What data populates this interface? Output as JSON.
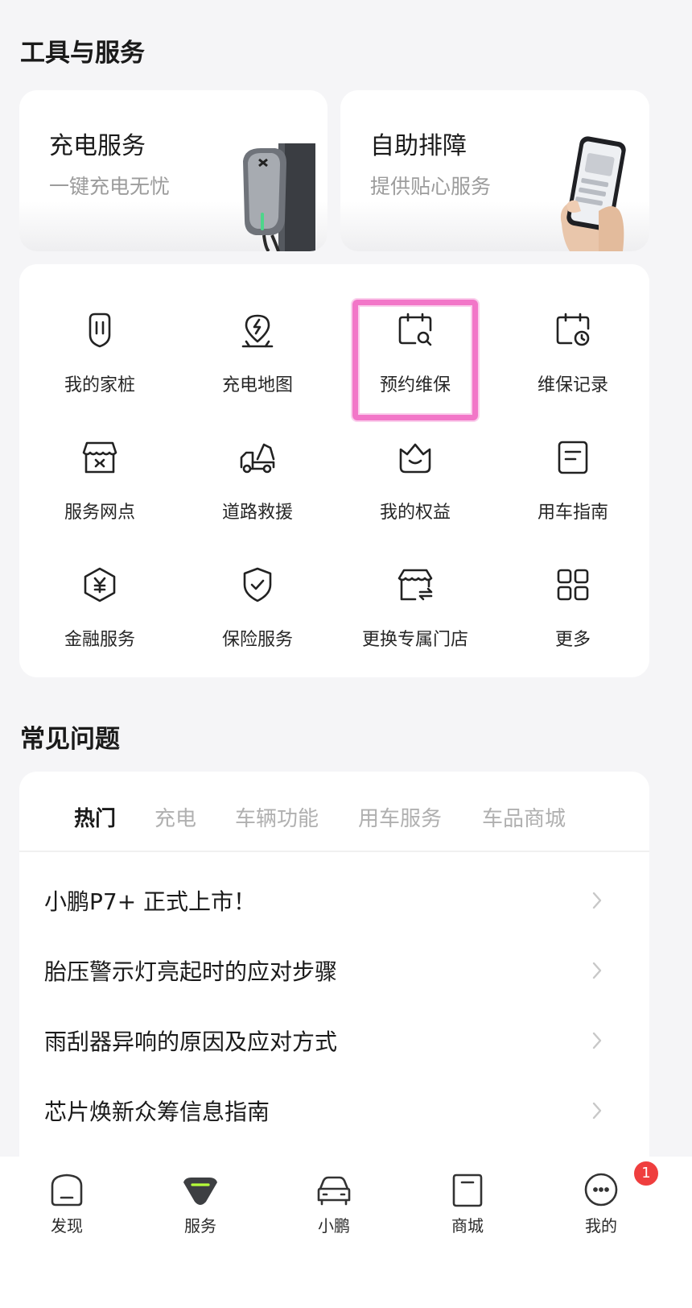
{
  "tools": {
    "title": "工具与服务",
    "feature_cards": [
      {
        "title": "充电服务",
        "subtitle": "一键充电无忧"
      },
      {
        "title": "自助排障",
        "subtitle": "提供贴心服务"
      }
    ],
    "grid": [
      {
        "label": "我的家桩",
        "icon": "charging-pile-icon"
      },
      {
        "label": "充电地图",
        "icon": "charging-map-icon"
      },
      {
        "label": "预约维保",
        "icon": "calendar-search-icon"
      },
      {
        "label": "维保记录",
        "icon": "calendar-clock-icon"
      },
      {
        "label": "服务网点",
        "icon": "service-store-icon"
      },
      {
        "label": "道路救援",
        "icon": "tow-truck-icon"
      },
      {
        "label": "我的权益",
        "icon": "benefits-basket-icon"
      },
      {
        "label": "用车指南",
        "icon": "guide-document-icon"
      },
      {
        "label": "金融服务",
        "icon": "finance-yen-icon"
      },
      {
        "label": "保险服务",
        "icon": "insurance-shield-icon"
      },
      {
        "label": "更换专属门店",
        "icon": "switch-store-icon"
      },
      {
        "label": "更多",
        "icon": "more-grid-icon"
      }
    ]
  },
  "faq": {
    "title": "常见问题",
    "tabs": [
      {
        "label": "热门",
        "active": true
      },
      {
        "label": "充电",
        "active": false
      },
      {
        "label": "车辆功能",
        "active": false
      },
      {
        "label": "用车服务",
        "active": false
      },
      {
        "label": "车品商城",
        "active": false
      }
    ],
    "items": [
      "小鹏P7+ 正式上市！",
      "胎压警示灯亮起时的应对步骤",
      "雨刮器异响的原因及应对方式",
      "芯片焕新众筹信息指南"
    ]
  },
  "bottom_nav": {
    "items": [
      {
        "label": "发现",
        "icon": "discover-icon",
        "active": false
      },
      {
        "label": "服务",
        "icon": "service-icon",
        "active": true
      },
      {
        "label": "小鹏",
        "icon": "car-icon",
        "active": false
      },
      {
        "label": "商城",
        "icon": "shop-bag-icon",
        "active": false
      },
      {
        "label": "我的",
        "icon": "profile-icon",
        "active": false
      }
    ],
    "badge": "1"
  },
  "colors": {
    "accent": "#b6ff3a",
    "highlight": "#f276c8",
    "badge": "#ef3e3e"
  }
}
